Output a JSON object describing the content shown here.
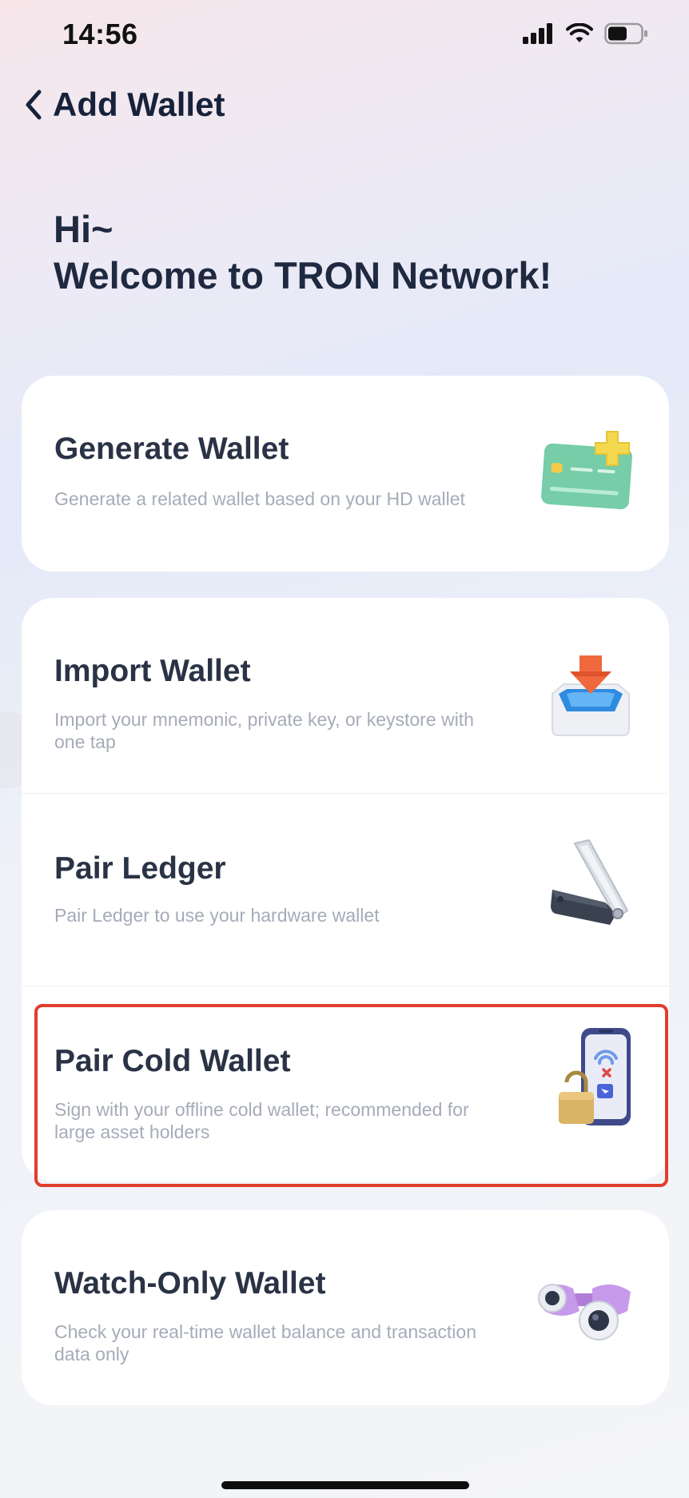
{
  "status_bar": {
    "time": "14:56",
    "icons": [
      "cellular-signal-icon",
      "wifi-icon",
      "battery-icon"
    ]
  },
  "nav": {
    "back_icon": "chevron-left-icon",
    "title": "Add Wallet"
  },
  "greeting": {
    "line1": "Hi~",
    "line2": "Welcome to TRON Network!"
  },
  "options": {
    "generate": {
      "title": "Generate Wallet",
      "desc": "Generate a related wallet based on your HD wallet",
      "icon": "card-plus-icon"
    },
    "import": {
      "title": "Import Wallet",
      "desc": "Import your mnemonic, private key, or keystore with one tap",
      "icon": "inbox-download-icon"
    },
    "ledger": {
      "title": "Pair Ledger",
      "desc": "Pair Ledger to use your hardware wallet",
      "icon": "ledger-device-icon"
    },
    "cold": {
      "title": "Pair Cold Wallet",
      "desc": "Sign with your offline cold wallet; recommended for large asset holders",
      "icon": "phone-lock-icon"
    },
    "watch": {
      "title": "Watch-Only Wallet",
      "desc": "Check your real-time wallet balance and transaction data only",
      "icon": "binoculars-icon"
    }
  },
  "colors": {
    "highlight_border": "#e23d2c",
    "title_text": "#2a3345",
    "desc_text": "#a6abb8"
  }
}
